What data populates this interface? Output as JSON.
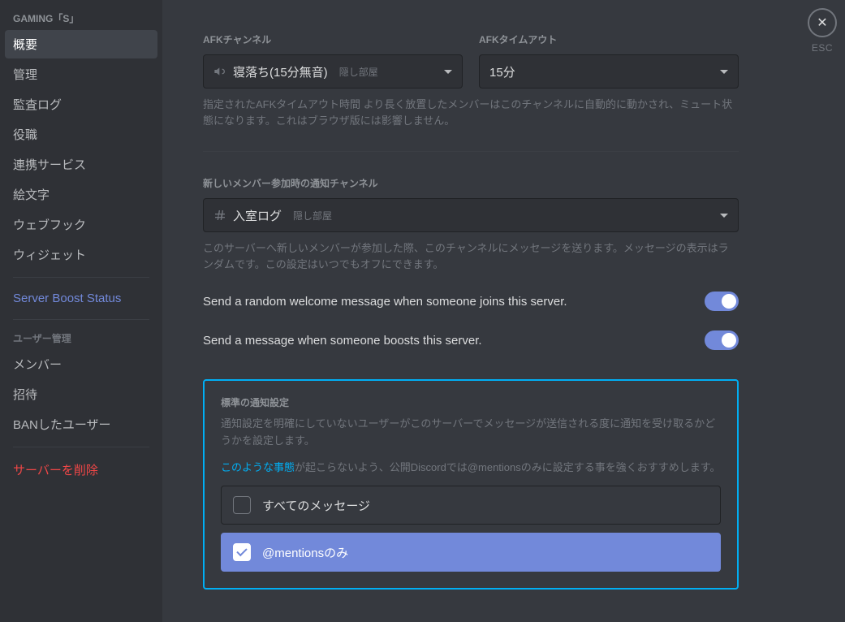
{
  "sidebar": {
    "header": "GAMING「S」",
    "items1": [
      {
        "label": "概要"
      },
      {
        "label": "管理"
      },
      {
        "label": "監査ログ"
      },
      {
        "label": "役職"
      },
      {
        "label": "連携サービス"
      },
      {
        "label": "絵文字"
      },
      {
        "label": "ウェブフック"
      },
      {
        "label": "ウィジェット"
      }
    ],
    "boost": "Server Boost Status",
    "subheader": "ユーザー管理",
    "items2": [
      {
        "label": "メンバー"
      },
      {
        "label": "招待"
      },
      {
        "label": "BANしたユーザー"
      }
    ],
    "delete": "サーバーを削除"
  },
  "close": {
    "label": "ESC"
  },
  "afk": {
    "channel_label": "AFKチャンネル",
    "channel_value": "寝落ち(15分無音)",
    "channel_sub": "隠し部屋",
    "timeout_label": "AFKタイムアウト",
    "timeout_value": "15分",
    "help": "指定されたAFKタイムアウト時間 より長く放置したメンバーはこのチャンネルに自動的に動かされ、ミュート状態になります。これはブラウザ版には影響しません。"
  },
  "newmember": {
    "label": "新しいメンバー参加時の通知チャンネル",
    "value": "入室ログ",
    "sub": "隠し部屋",
    "help": "このサーバーへ新しいメンバーが参加した際、このチャンネルにメッセージを送ります。メッセージの表示はランダムです。この設定はいつでもオフにできます。"
  },
  "toggles": {
    "welcome": "Send a random welcome message when someone joins this server.",
    "boost": "Send a message when someone boosts this server."
  },
  "notify": {
    "title": "標準の通知設定",
    "help": "通知設定を明確にしていないユーザーがこのサーバーでメッセージが送信される度に通知を受け取るかどうかを設定します。",
    "link": "このような事態",
    "recommend": "が起こらないよう、公開Discordでは@mentionsのみに設定する事を強くおすすめします。",
    "opt1": "すべてのメッセージ",
    "opt2": "@mentionsのみ"
  }
}
